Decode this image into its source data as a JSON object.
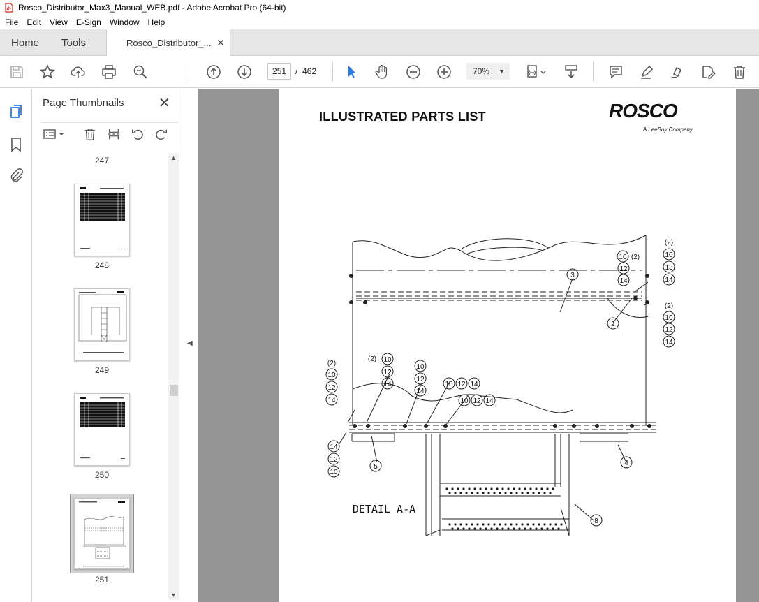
{
  "window": {
    "title": "Rosco_Distributor_Max3_Manual_WEB.pdf - Adobe Acrobat Pro (64-bit)"
  },
  "menu": [
    "File",
    "Edit",
    "View",
    "E-Sign",
    "Window",
    "Help"
  ],
  "tabs": {
    "home": "Home",
    "tools": "Tools",
    "document": "Rosco_Distributor_..."
  },
  "toolbar": {
    "page_current": "251",
    "page_separator": "/",
    "page_total": "462",
    "zoom": "70%"
  },
  "thumbnails": {
    "title": "Page Thumbnails",
    "pages": [
      "247",
      "248",
      "249",
      "250",
      "251"
    ],
    "selected": "251"
  },
  "document": {
    "heading": "ILLUSTRATED PARTS LIST",
    "brand": "ROSCO",
    "tagline": "A LeeBoy Company",
    "detail_label": "DETAIL A-A",
    "callouts": {
      "c_top_right_1": [
        "(2)",
        "10",
        "13",
        "14"
      ],
      "c_top_right_2": [
        "(2)",
        "10",
        "12",
        "14"
      ],
      "c_top_mid": [
        "10",
        "(2)",
        "12",
        "14"
      ],
      "c_left": [
        "(2)",
        "10",
        "12",
        "14"
      ],
      "c_left_bottom": [
        "14",
        "12",
        "10"
      ],
      "c_mid1": [
        "(2)",
        "10",
        "12",
        "14"
      ],
      "c_mid2": [
        "10",
        "12",
        "14"
      ],
      "c_row1": [
        "10",
        "12",
        "14"
      ],
      "c_row2": [
        "10",
        "12",
        "14"
      ],
      "items": [
        "3",
        "2",
        "5",
        "4",
        "8"
      ]
    }
  },
  "colors": {
    "doc_bg": "#959595",
    "accent": "#2d7be5",
    "pdf_red": "#d9261c"
  }
}
